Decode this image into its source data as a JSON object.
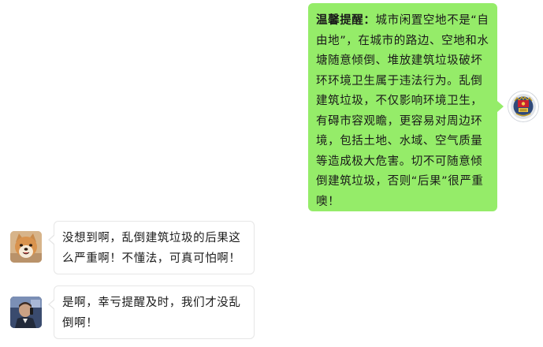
{
  "messages": [
    {
      "side": "right",
      "avatar": "police-emblem-icon",
      "bold_prefix": "温馨提醒：",
      "text": "城市闲置空地不是“自由地”，在城市的路边、空地和水塘随意倾倒、堆放建筑垃圾破坏环环境卫生属于违法行为。乱倒建筑垃圾，不仅影响环境卫生，有碍市容观瞻，更容易对周边环境，包括土地、水域、空气质量等造成极大危害。切不可随意倾倒建筑垃圾，否则“后果”很严重噢！",
      "bubble_color": "#95ec69"
    },
    {
      "side": "left",
      "avatar": "shiba-dog-avatar",
      "text": "没想到啊，乱倒建筑垃圾的后果这么严重啊！不懂法，可真可怕啊！",
      "bubble_color": "#ffffff"
    },
    {
      "side": "left",
      "avatar": "man-phone-avatar",
      "text": "是啊，幸亏提醒及时，我们才没乱倒啊！",
      "bubble_color": "#ffffff"
    }
  ]
}
